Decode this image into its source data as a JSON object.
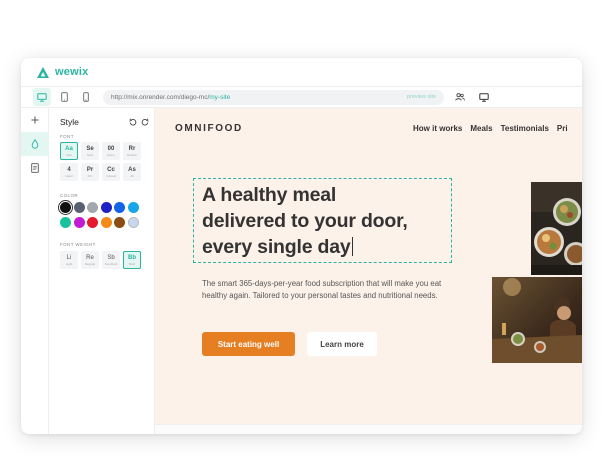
{
  "app": {
    "name": "wewix",
    "brand_color": "#2bb5a0"
  },
  "toolbar": {
    "devices": [
      "desktop-icon",
      "tablet-icon",
      "mobile-icon"
    ],
    "url_prefix": "http://mix.onrender.com/diego-mc/",
    "url_slug": "my-site",
    "preview_label": "preview site",
    "right_icons": [
      "users-icon",
      "monitor-icon"
    ]
  },
  "rail": {
    "items": [
      "plus-icon",
      "brush-icon",
      "page-icon"
    ]
  },
  "style_panel": {
    "title": "Style",
    "font_label": "FONT",
    "fonts": [
      {
        "main": "Aa",
        "sub": "Inter"
      },
      {
        "main": "Se",
        "sub": "Serif"
      },
      {
        "main": "00",
        "sub": "Mono"
      },
      {
        "main": "Rr",
        "sub": "Roboto"
      },
      {
        "main": "4",
        "sub": "Hand"
      },
      {
        "main": "Pr",
        "sub": "Pro"
      },
      {
        "main": "Cc",
        "sub": "Casual"
      },
      {
        "main": "As",
        "sub": "Alt"
      }
    ],
    "selected_font": 0,
    "color_label": "COLOR",
    "colors": [
      "#111111",
      "#596273",
      "#a3a8b0",
      "#1e22c4",
      "#1263e6",
      "#18a6e8",
      "#18c29c",
      "#c11bd6",
      "#e41b2c",
      "#f28b17",
      "#8a4c13",
      "#c8d8f0"
    ],
    "selected_color": 0,
    "weight_label": "FONT WEIGHT",
    "weights": [
      {
        "main": "Li",
        "sub": "Light"
      },
      {
        "main": "Re",
        "sub": "Regular"
      },
      {
        "main": "Sb",
        "sub": "Semibold"
      },
      {
        "main": "Bb",
        "sub": "Bold"
      }
    ],
    "selected_weight": 3
  },
  "site": {
    "logo": "OMNIFOOD",
    "nav": [
      "How it works",
      "Meals",
      "Testimonials",
      "Pri"
    ],
    "hero_lines": [
      "A healthy meal",
      "delivered to your door,",
      "every single day"
    ],
    "hero_text": "The smart 365-days-per-year food subscription that will make you eat healthy again. Tailored to your personal tastes and nutritional needs.",
    "cta_primary": "Start eating well",
    "cta_secondary": "Learn more",
    "bg_color": "#fdf2e9",
    "accent_color": "#e67e22"
  }
}
